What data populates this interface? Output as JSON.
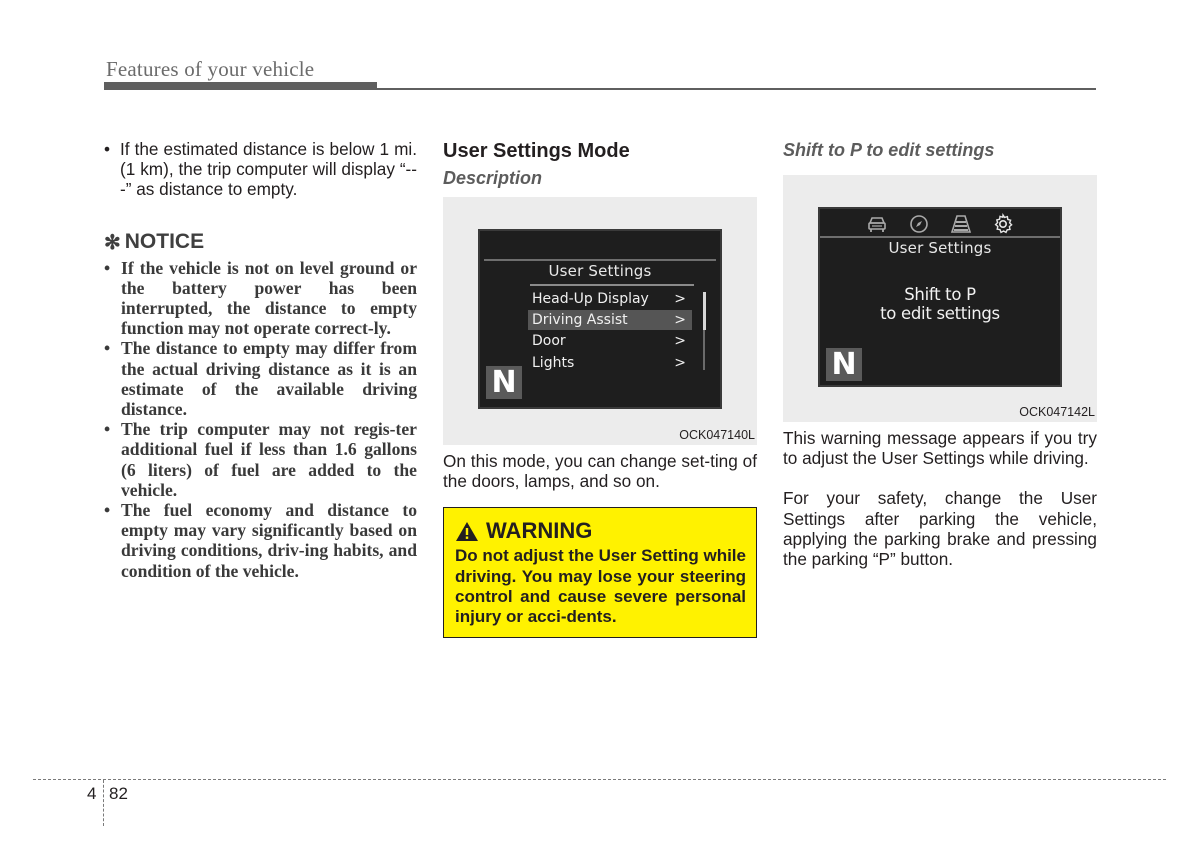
{
  "header": {
    "title": "Features of your vehicle"
  },
  "left_column": {
    "intro_bullet": "If the estimated distance is below 1 mi. (1 km), the trip computer will display “---” as distance to empty.",
    "notice": {
      "symbol": "✻",
      "title": "NOTICE",
      "items": [
        "If the vehicle is not on level ground or the battery power has been interrupted, the distance to empty function may not operate correct-ly.",
        "The distance to empty may differ from the actual driving distance as it is an estimate of the available driving distance.",
        "The trip computer may not regis-ter additional fuel if less than 1.6 gallons (6 liters) of fuel are added to the vehicle.",
        "The fuel economy and distance to empty may vary significantly based on driving conditions, driv-ing habits, and condition of the vehicle."
      ]
    }
  },
  "middle_column": {
    "title": "User Settings Mode",
    "subtitle": "Description",
    "figure": {
      "screen_heading": "User Settings",
      "menu_items": [
        {
          "label": "Head-Up Display",
          "chevron": ">",
          "selected": false
        },
        {
          "label": "Driving Assist",
          "chevron": ">",
          "selected": true
        },
        {
          "label": "Door",
          "chevron": ">",
          "selected": false
        },
        {
          "label": "Lights",
          "chevron": ">",
          "selected": false
        }
      ],
      "gear_indicator": "N",
      "code": "OCK047140L"
    },
    "paragraph": "On this mode, you can change set-ting of the doors, lamps, and so on.",
    "warning": {
      "icon": "warning-triangle",
      "title": "WARNING",
      "body": "Do not adjust the User Setting while driving. You may lose your steering control and cause severe personal injury or acci-dents."
    },
    "colors": {
      "warning_bg": "#fff200"
    }
  },
  "right_column": {
    "subtitle": "Shift to P to edit settings",
    "figure": {
      "tab_icons": [
        "car-icon",
        "compass-icon",
        "road-icon",
        "gear-icon"
      ],
      "screen_heading": "User Settings",
      "message_line1": "Shift to P",
      "message_line2": "to edit settings",
      "gear_indicator": "N",
      "code": "OCK047142L"
    },
    "paragraph1": "This warning message appears if you try to adjust the User Settings while driving.",
    "paragraph2": "For your safety, change the User Settings after parking the vehicle, applying the parking brake and pressing the parking “P” button."
  },
  "footer": {
    "chapter": "4",
    "page": "82"
  }
}
